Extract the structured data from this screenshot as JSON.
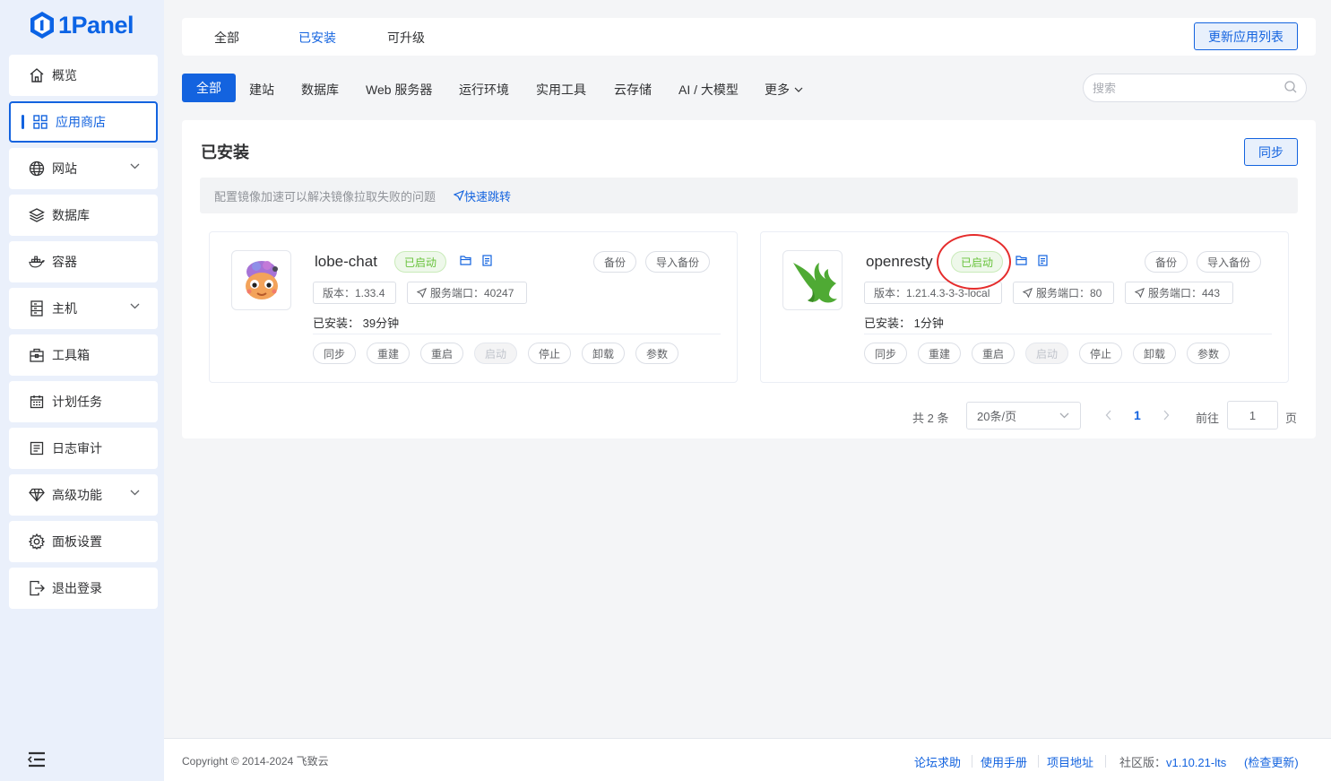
{
  "app": {
    "logo_text": "1Panel"
  },
  "sidebar": {
    "items": [
      {
        "label": "概览",
        "icon": "home-icon"
      },
      {
        "label": "应用商店",
        "icon": "grid-icon"
      },
      {
        "label": "网站",
        "icon": "globe-icon"
      },
      {
        "label": "数据库",
        "icon": "layers-icon"
      },
      {
        "label": "容器",
        "icon": "docker-icon"
      },
      {
        "label": "主机",
        "icon": "server-icon"
      },
      {
        "label": "工具箱",
        "icon": "toolbox-icon"
      },
      {
        "label": "计划任务",
        "icon": "calendar-icon"
      },
      {
        "label": "日志审计",
        "icon": "log-icon"
      },
      {
        "label": "高级功能",
        "icon": "diamond-icon"
      },
      {
        "label": "面板设置",
        "icon": "gear-icon"
      },
      {
        "label": "退出登录",
        "icon": "logout-icon"
      }
    ]
  },
  "top_tabs": [
    "全部",
    "已安装",
    "可升级"
  ],
  "update_list_button": "更新应用列表",
  "categories": [
    "全部",
    "建站",
    "数据库",
    "Web 服务器",
    "运行环境",
    "实用工具",
    "云存储",
    "AI / 大模型",
    "更多"
  ],
  "search": {
    "placeholder": "搜索"
  },
  "installed_panel": {
    "title": "已安装",
    "sync_button": "同步",
    "notice": "配置镜像加速可以解决镜像拉取失败的问题",
    "notice_link": "快速跳转"
  },
  "apps": [
    {
      "name": "lobe-chat",
      "status": "已启动",
      "backup": "备份",
      "import_backup": "导入备份",
      "version": "版本：1.33.4",
      "ports": [
        "服务端口：40247"
      ],
      "installed": "已安装：  39分钟",
      "actions": [
        "同步",
        "重建",
        "重启",
        "启动",
        "停止",
        "卸载",
        "参数"
      ]
    },
    {
      "name": "openresty",
      "status": "已启动",
      "backup": "备份",
      "import_backup": "导入备份",
      "version": "版本：1.21.4.3-3-3-local",
      "ports": [
        "服务端口：80",
        "服务端口：443"
      ],
      "installed": "已安装：  1分钟",
      "actions": [
        "同步",
        "重建",
        "重启",
        "启动",
        "停止",
        "卸载",
        "参数"
      ]
    }
  ],
  "pagination": {
    "total": "共 2 条",
    "page_size": "20条/页",
    "current": "1",
    "goto_label": "前往",
    "goto_value": "1",
    "page_suffix": "页"
  },
  "footer": {
    "copyright": "Copyright © 2014-2024 飞致云",
    "links": [
      "论坛求助",
      "使用手册",
      "项目地址"
    ],
    "edition_label": "社区版：",
    "version": "v1.10.21-lts",
    "check_update": "(检查更新)"
  },
  "colors": {
    "primary": "#1363df",
    "success": "#67c23a",
    "annotation": "#e52c2c"
  }
}
